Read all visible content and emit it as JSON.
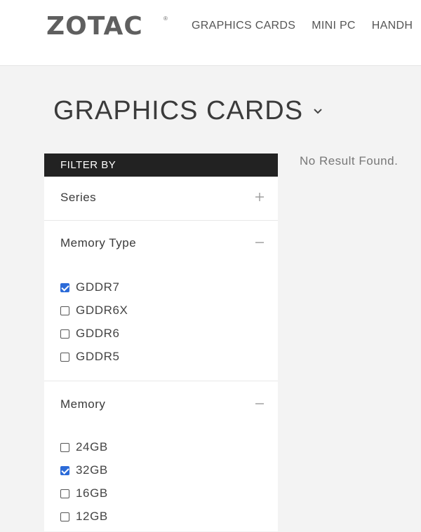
{
  "header": {
    "logo_text": "ZOTAC",
    "logo_mark": "®",
    "nav": [
      "GRAPHICS CARDS",
      "MINI PC",
      "HANDH"
    ]
  },
  "page": {
    "title": "GRAPHICS CARDS",
    "dropdown_icon": "chevron-down-icon"
  },
  "filter": {
    "heading": "FILTER BY",
    "sections": [
      {
        "title": "Series",
        "state": "collapsed",
        "icon": "plus-icon"
      },
      {
        "title": "Memory Type",
        "state": "expanded",
        "icon": "minus-icon",
        "options": [
          {
            "label": "GDDR7",
            "checked": true
          },
          {
            "label": "GDDR6X",
            "checked": false
          },
          {
            "label": "GDDR6",
            "checked": false
          },
          {
            "label": "GDDR5",
            "checked": false
          }
        ]
      },
      {
        "title": "Memory",
        "state": "expanded",
        "icon": "minus-icon",
        "options": [
          {
            "label": "24GB",
            "checked": false
          },
          {
            "label": "32GB",
            "checked": true
          },
          {
            "label": "16GB",
            "checked": false
          },
          {
            "label": "12GB",
            "checked": false
          }
        ]
      }
    ]
  },
  "results": {
    "message": "No Result Found."
  },
  "colors": {
    "accent": "#2c6bd8",
    "filter_header_bg": "#222222",
    "page_bg": "#f3f3f3"
  }
}
